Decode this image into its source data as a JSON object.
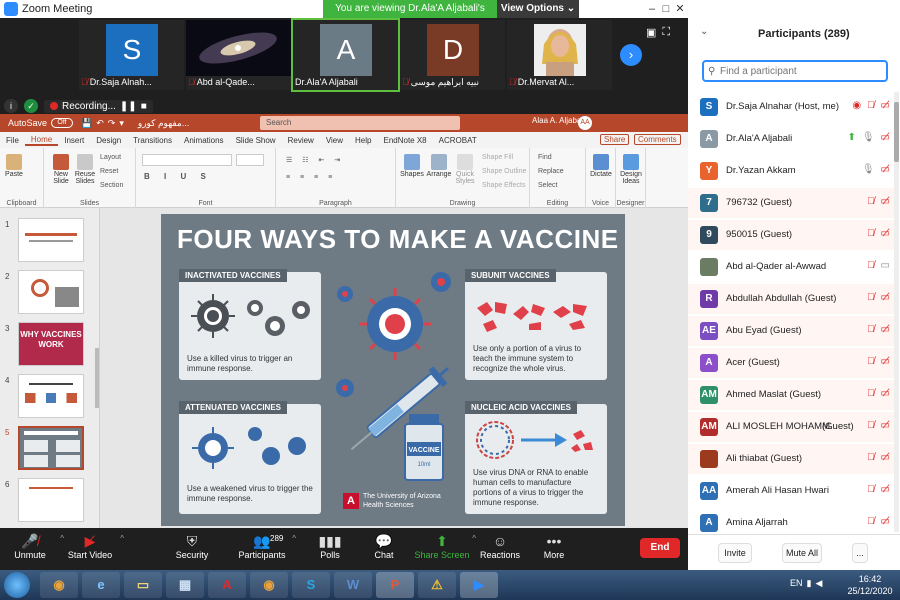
{
  "zoom": {
    "title": "Zoom Meeting",
    "viewing_banner": "You are viewing Dr.Ala'A Aljabali's screen",
    "view_options": "View Options ⌄"
  },
  "video_tiles": [
    {
      "initial": "S",
      "name": "Dr.Saja Alnah...",
      "color": "#1c6fbf",
      "muted": true
    },
    {
      "initial": "",
      "name": "Abd al-Qade...",
      "color": "#000000",
      "muted": true
    },
    {
      "initial": "A",
      "name": "Dr.Ala'A Aljabali",
      "color": "#6b7b86",
      "muted": false,
      "active": true
    },
    {
      "initial": "D",
      "name": "نبيه ابراهيم موسى",
      "color": "#7a3b26",
      "muted": true
    },
    {
      "initial": "",
      "name": "Dr.Mervat Al...",
      "color": "#d9a98b",
      "muted": true
    }
  ],
  "recording": {
    "label": "Recording..."
  },
  "ppt": {
    "autosave_label": "AutoSave",
    "autosave_state": "Off",
    "doc_name": "مفهوم كورو...",
    "search_placeholder": "Search",
    "user_name": "Alaa A. Aljabali",
    "user_initials": "AA",
    "tabs": [
      "File",
      "Home",
      "Insert",
      "Design",
      "Transitions",
      "Animations",
      "Slide Show",
      "Review",
      "View",
      "Help",
      "EndNote X8",
      "ACROBAT"
    ],
    "selected_tab": "Home",
    "share_label": "Share",
    "comments_label": "Comments",
    "groups": {
      "clipboard": "Clipboard",
      "slides": "Slides",
      "font": "Font",
      "paragraph": "Paragraph",
      "drawing": "Drawing",
      "editing": "Editing",
      "voice": "Voice",
      "designer": "Designer"
    },
    "buttons": {
      "paste": "Paste",
      "new_slide": "New Slide",
      "reuse_slides": "Reuse Slides",
      "layout": "Layout",
      "reset": "Reset",
      "section": "Section",
      "shapes": "Shapes",
      "arrange": "Arrange",
      "quick_styles": "Quick Styles",
      "shape_fill": "Shape Fill",
      "shape_outline": "Shape Outline",
      "shape_effects": "Shape Effects",
      "find": "Find",
      "replace": "Replace",
      "select": "Select",
      "dictate": "Dictate",
      "design_ideas": "Design Ideas"
    },
    "slide_numbers": [
      "1",
      "2",
      "3",
      "4",
      "5",
      "6"
    ],
    "selected_slide": "5",
    "thumb3_text": "WHY VACCINES WORK",
    "slide": {
      "title": "FOUR WAYS TO MAKE A VACCINE",
      "inactivated_head": "INACTIVATED VACCINES",
      "inactivated_text": "Use a killed virus to trigger an immune response.",
      "subunit_head": "SUBUNIT VACCINES",
      "subunit_text": "Use only a portion of a virus to teach the immune system to recognize the whole virus.",
      "attenuated_head": "ATTENUATED VACCINES",
      "attenuated_text": "Use a weakened virus to trigger the immune response.",
      "nucleic_head": "NUCLEIC ACID VACCINES",
      "nucleic_text": "Use virus DNA or RNA to enable human cells to manufacture portions of a virus to trigger the immune response.",
      "vial_label": "VACCINE",
      "vial_sub": "10ml",
      "university_logo": "A",
      "university": "The University of Arizona Health Sciences"
    }
  },
  "toolbar": {
    "unmute": "Unmute",
    "start_video": "Start Video",
    "security": "Security",
    "participants": "Participants",
    "participant_count": "289",
    "polls": "Polls",
    "chat": "Chat",
    "share_screen": "Share Screen",
    "reactions": "Reactions",
    "more": "More",
    "end": "End"
  },
  "participants_panel": {
    "title": "Participants (289)",
    "search_placeholder": "Find a participant",
    "invite": "Invite",
    "mute_all": "Mute All",
    "more": "...",
    "list": [
      {
        "initials": "S",
        "name": "Dr.Saja Alnahar (Host, me)",
        "color": "#1c6fbf",
        "guest": false,
        "rec": true,
        "mic": "off",
        "video": "off"
      },
      {
        "initials": "A",
        "name": "Dr.Ala'A Aljabali",
        "color": "#8a99a3",
        "guest": false,
        "share": true,
        "mic": "on",
        "video": "off"
      },
      {
        "initials": "Y",
        "name": "Dr.Yazan Akkam",
        "color": "#e8632d",
        "guest": false,
        "mic": "on",
        "video": "off"
      },
      {
        "initials": "7",
        "name": "796732 (Guest)",
        "color": "#2f6d8c",
        "guest": true,
        "mic": "off",
        "video": "off"
      },
      {
        "initials": "9",
        "name": "950015 (Guest)",
        "color": "#2f4a5c",
        "guest": true,
        "mic": "off",
        "video": "off"
      },
      {
        "initials": "",
        "name": "Abd al-Qader al-Awwad",
        "color": "#6a7d63",
        "guest": false,
        "mic": "off",
        "video": "on"
      },
      {
        "initials": "R",
        "name": "Abdullah Abdullah (Guest)",
        "color": "#6e3aa8",
        "guest": true,
        "mic": "off",
        "video": "off"
      },
      {
        "initials": "AE",
        "name": "Abu Eyad (Guest)",
        "color": "#7b4fc2",
        "guest": true,
        "mic": "off",
        "video": "off"
      },
      {
        "initials": "A",
        "name": "Acer (Guest)",
        "color": "#8a4fc9",
        "guest": true,
        "mic": "off",
        "video": "off"
      },
      {
        "initials": "AM",
        "name": "Ahmed Maslat (Guest)",
        "color": "#2e8f68",
        "guest": true,
        "mic": "off",
        "video": "off"
      },
      {
        "initials": "AM",
        "name": "ALI MOSLEH MOHAMM...",
        "suffix": "(Guest)",
        "color": "#b22c2c",
        "guest": true,
        "mic": "off",
        "video": "off"
      },
      {
        "initials": "",
        "name": "Ali thiabat (Guest)",
        "color": "#9c3a1e",
        "guest": true,
        "mic": "off",
        "video": "off"
      },
      {
        "initials": "AA",
        "name": "Amerah Ali Hasan Hwari",
        "color": "#2f6fb3",
        "guest": false,
        "mic": "off",
        "video": "off"
      },
      {
        "initials": "A",
        "name": "Amina Aljarrah",
        "color": "#2f6fb3",
        "guest": false,
        "mic": "off",
        "video": "off"
      }
    ]
  },
  "taskbar": {
    "tray_lang": "EN",
    "time": "16:42",
    "date": "25/12/2020",
    "apps": [
      "chrome",
      "ie",
      "explorer",
      "calc",
      "acrobat",
      "chrome",
      "skype",
      "word",
      "powerpoint",
      "warning",
      "zoom"
    ]
  }
}
